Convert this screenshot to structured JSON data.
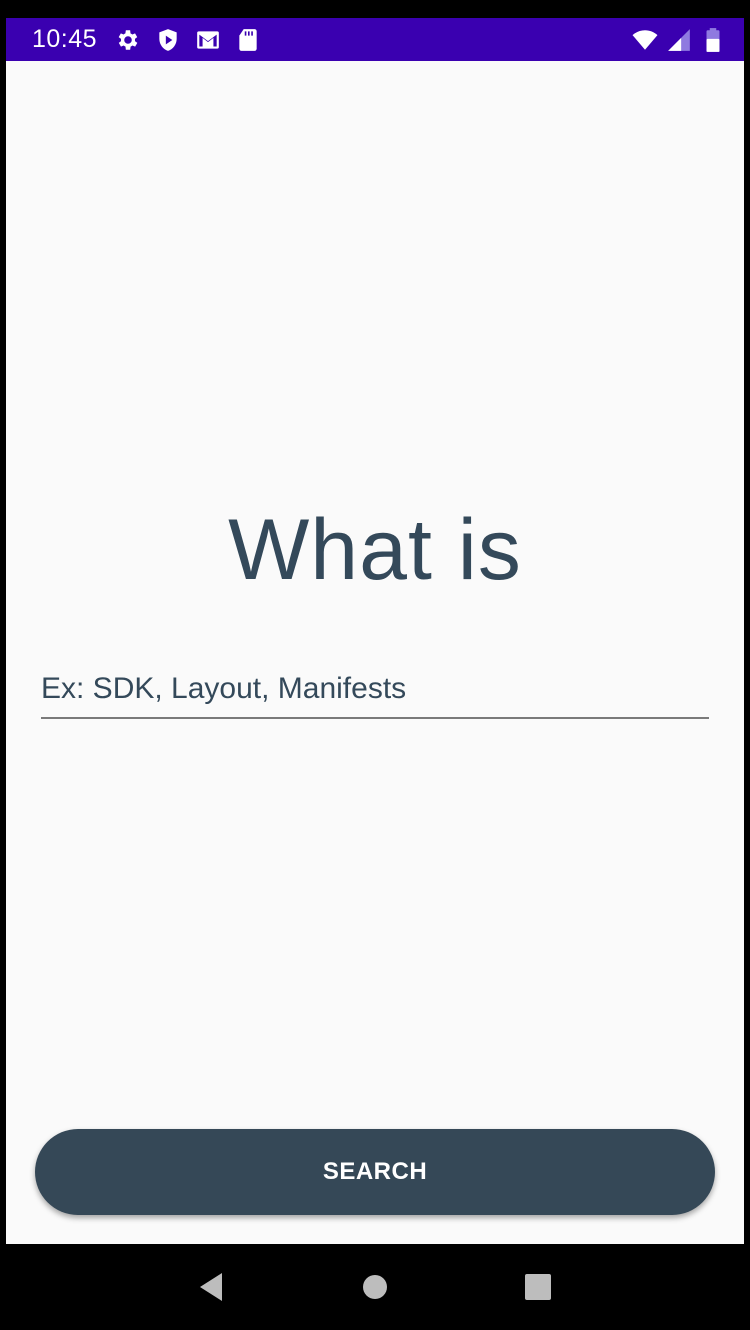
{
  "status_bar": {
    "time": "10:45",
    "left_icons": [
      "gear-icon",
      "shield-icon",
      "gmail-icon",
      "sd-card-icon"
    ],
    "right_icons": [
      "wifi-icon",
      "signal-icon",
      "battery-icon"
    ],
    "background": "#3a00b0"
  },
  "main": {
    "title": "What is",
    "search_input": {
      "value": "",
      "placeholder": "Ex: SDK, Layout, Manifests"
    },
    "search_button_label": "SEARCH"
  },
  "nav_bar": {
    "buttons": [
      "back-icon",
      "home-icon",
      "recents-icon"
    ]
  },
  "colors": {
    "title_text": "#34495a",
    "button_bg": "#354857",
    "app_bg": "#fafafa"
  }
}
